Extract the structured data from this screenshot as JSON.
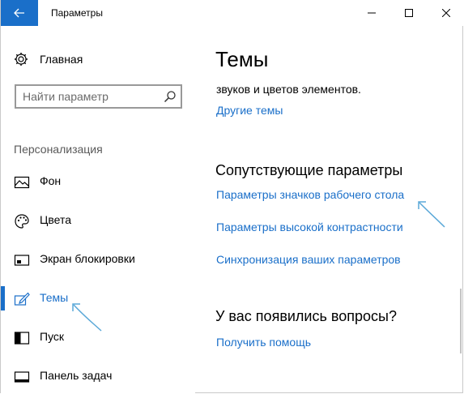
{
  "window": {
    "title": "Параметры"
  },
  "sidebar": {
    "home_label": "Главная",
    "search_placeholder": "Найти параметр",
    "section_label": "Персонализация",
    "items": [
      {
        "label": "Фон",
        "icon": "image-icon",
        "active": false
      },
      {
        "label": "Цвета",
        "icon": "palette-icon",
        "active": false
      },
      {
        "label": "Экран блокировки",
        "icon": "lock-screen-icon",
        "active": false
      },
      {
        "label": "Темы",
        "icon": "brush-icon",
        "active": true
      },
      {
        "label": "Пуск",
        "icon": "start-icon",
        "active": false
      },
      {
        "label": "Панель задач",
        "icon": "taskbar-icon",
        "active": false
      }
    ]
  },
  "main": {
    "title": "Темы",
    "cut_text": "звуков и цветов элементов.",
    "other_themes_link": "Другие темы",
    "related_heading": "Сопутствующие параметры",
    "related_links": [
      "Параметры значков рабочего стола",
      "Параметры высокой контрастности",
      "Синхронизация ваших параметров"
    ],
    "questions_heading": "У вас появились вопросы?",
    "help_link": "Получить помощь"
  },
  "colors": {
    "accent": "#1a6fc9",
    "sidebar_bg": "#f2f2f2",
    "annotation_arrow": "#5aa8d8"
  }
}
